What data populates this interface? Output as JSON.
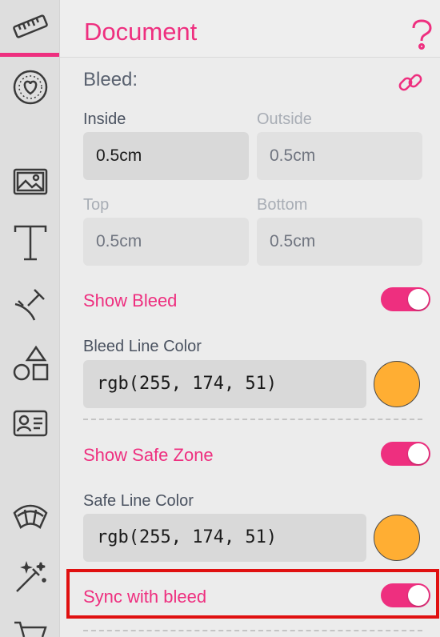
{
  "header": {
    "title": "Document"
  },
  "bleed": {
    "title": "Bleed:",
    "fields": [
      {
        "label": "Inside",
        "value": "0.5cm"
      },
      {
        "label": "Outside",
        "value": "0.5cm"
      },
      {
        "label": "Top",
        "value": "0.5cm"
      },
      {
        "label": "Bottom",
        "value": "0.5cm"
      }
    ]
  },
  "show_bleed": {
    "label": "Show Bleed",
    "on": true
  },
  "bleed_line_color": {
    "label": "Bleed Line Color",
    "value": "rgb(255, 174, 51)",
    "swatch": "#ffae33"
  },
  "show_safe_zone": {
    "label": "Show Safe Zone",
    "on": true
  },
  "safe_line_color": {
    "label": "Safe Line Color",
    "value": "rgb(255, 174, 51)",
    "swatch": "#ffae33"
  },
  "sync_with_bleed": {
    "label": "Sync with bleed",
    "on": true
  },
  "colors": {
    "accent": "#ee2f7f",
    "highlight": "#e01010"
  },
  "rail_icons": [
    "ruler-icon",
    "heart-badge-icon",
    "image-icon",
    "text-icon",
    "line-tool-icon",
    "shapes-icon",
    "contact-card-icon",
    "arc-icon",
    "magic-wand-icon",
    "cart-icon"
  ]
}
